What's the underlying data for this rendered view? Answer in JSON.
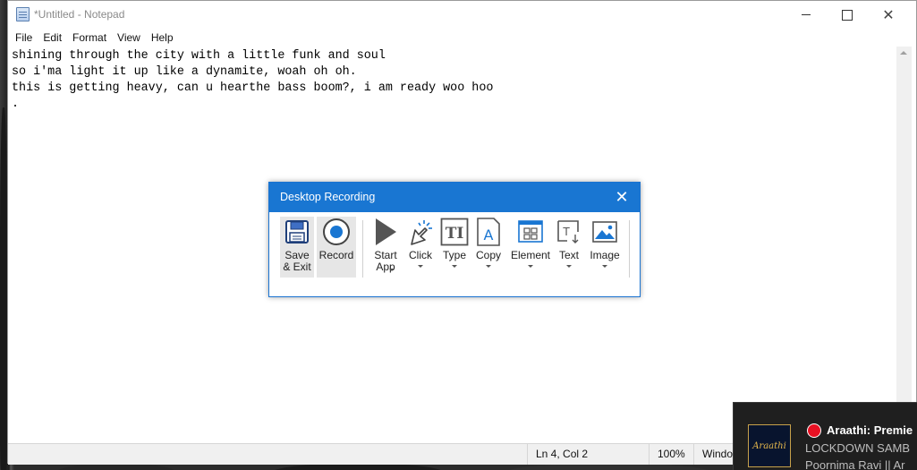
{
  "window": {
    "title": "*Untitled - Notepad",
    "close_glyph": "✕"
  },
  "menu": [
    "File",
    "Edit",
    "Format",
    "View",
    "Help"
  ],
  "editor": {
    "lines": [
      "shining through the city with a little funk and soul",
      "so i'ma light it up like a dynamite, woah oh oh.",
      "this is getting heavy, can u hearthe bass boom?, i am ready woo hoo",
      "."
    ]
  },
  "status": {
    "position": "Ln 4, Col 2",
    "zoom": "100%",
    "line_ending": "Windo"
  },
  "recorder": {
    "title": "Desktop Recording",
    "close_glyph": "✕",
    "tools": [
      {
        "label": "Save\n& Exit",
        "icon": "floppy-disk-icon"
      },
      {
        "label": "Record",
        "icon": "record-icon"
      },
      {
        "label": "Start\nApp",
        "icon": "play-icon",
        "dropdown": true
      },
      {
        "label": "Click",
        "icon": "cursor-click-icon",
        "dropdown": true
      },
      {
        "label": "Type",
        "icon": "type-icon",
        "dropdown": true
      },
      {
        "label": "Copy",
        "icon": "copy-text-icon",
        "dropdown": true
      },
      {
        "label": "Element",
        "icon": "element-icon",
        "dropdown": true
      },
      {
        "label": "Text",
        "icon": "text-icon",
        "dropdown": true
      },
      {
        "label": "Image",
        "icon": "image-icon",
        "dropdown": true
      }
    ]
  },
  "notification": {
    "title": "Araathi: Premie",
    "line1": "LOCKDOWN SAMB",
    "line2": "Poornima Ravi || Ar",
    "thumb_text": "Araathi"
  },
  "colors": {
    "accent": "#1976d2",
    "live_red": "#e81123"
  }
}
